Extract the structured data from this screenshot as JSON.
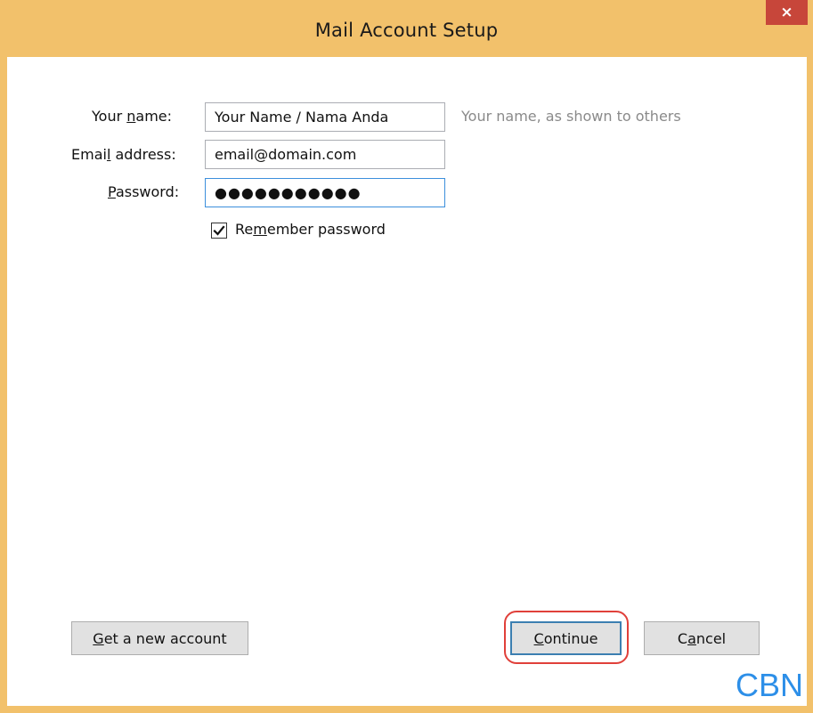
{
  "window": {
    "title": "Mail Account Setup",
    "close_glyph": "×"
  },
  "form": {
    "name": {
      "label_pre": "Your ",
      "label_access": "n",
      "label_post": "ame:",
      "value": "Your Name / Nama Anda",
      "hint": "Your name, as shown to others"
    },
    "email": {
      "label_pre": "Emai",
      "label_access": "l",
      "label_post": " address:",
      "value": "email@domain.com"
    },
    "password": {
      "label_pre": "",
      "label_access": "P",
      "label_post": "assword:",
      "value": "●●●●●●●●●●●"
    },
    "remember": {
      "label_pre": "Re",
      "label_access": "m",
      "label_post": "ember password",
      "checked": true
    }
  },
  "buttons": {
    "new_account": {
      "pre": "",
      "access": "G",
      "post": "et a new account"
    },
    "continue": {
      "pre": "",
      "access": "C",
      "post": "ontinue"
    },
    "cancel": {
      "pre": "C",
      "access": "a",
      "post": "ncel"
    }
  },
  "watermark": "CBN",
  "colors": {
    "titlebar": "#f2c16b",
    "close": "#c7463a",
    "focus_border": "#3c8fdc",
    "highlight_ring": "#e0403a",
    "watermark": "#2d8fe8"
  },
  "icons": {
    "close": "close-icon",
    "checkbox_mark": "checkmark-icon"
  }
}
